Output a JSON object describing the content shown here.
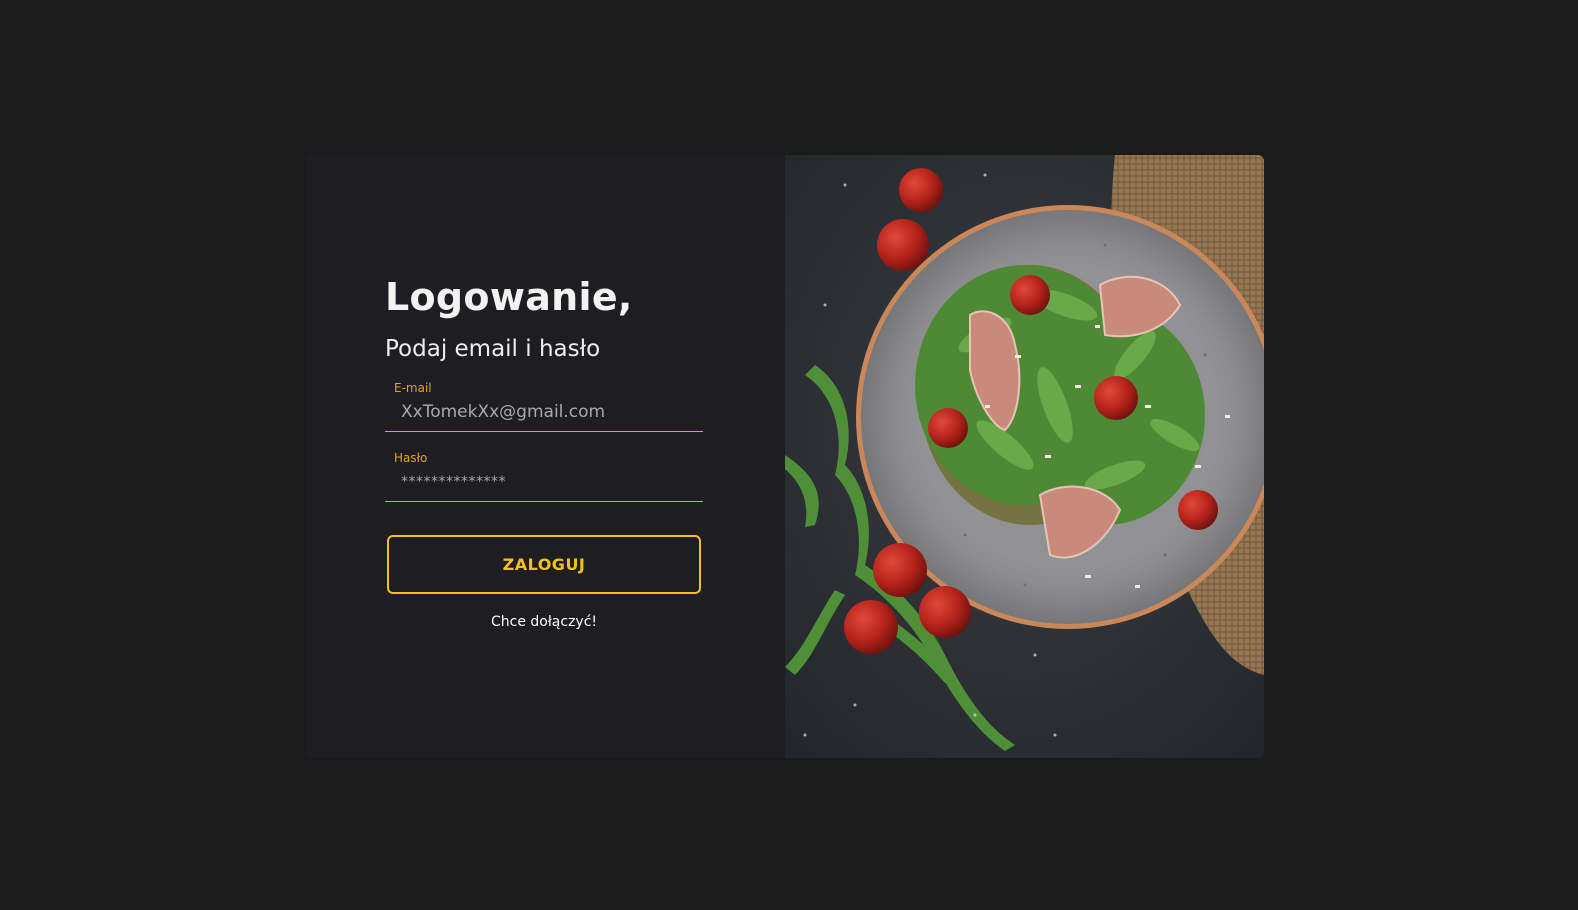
{
  "login": {
    "title": "Logowanie,",
    "subtitle": "Podaj email i hasło",
    "email": {
      "label": "E-mail",
      "value": "XxTomekXx@gmail.com"
    },
    "password": {
      "label": "Hasło",
      "value": "**************"
    },
    "submit_label": "ZALOGUJ",
    "join_link": "Chce dołączyć!"
  },
  "image": {
    "icon": "salad-plate-photo"
  },
  "colors": {
    "background": "#1b1b1c",
    "card": "#1e1e22",
    "accent": "#f2c21b",
    "field_label": "#e0a41a"
  }
}
